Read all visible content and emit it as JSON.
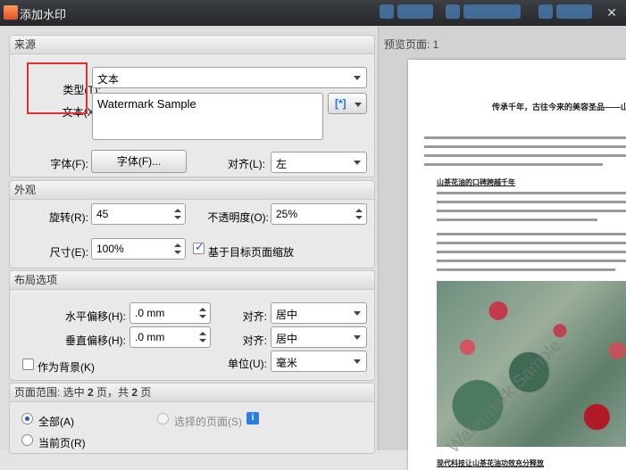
{
  "window": {
    "title": "添加水印"
  },
  "source": {
    "header": "来源",
    "type_label": "类型(T):",
    "type_value": "文本",
    "text_label": "文本(X):",
    "text_value": "Watermark Sample",
    "font_label": "字体(F):",
    "font_button": "字体(F)...",
    "align_label": "对齐(L):",
    "align_value": "左"
  },
  "appearance": {
    "header": "外观",
    "rotation_label": "旋转(R):",
    "rotation_value": "45",
    "opacity_label": "不透明度(O):",
    "opacity_value": "25%",
    "size_label": "尺寸(E):",
    "size_value": "100%",
    "scale_label": "基于目标页面缩放",
    "scale_checked": true
  },
  "layout": {
    "header": "布局选项",
    "hoffset_label": "水平偏移(H):",
    "hoffset_value": ".0 mm",
    "halign_label": "对齐:",
    "halign_value": "居中",
    "voffset_label": "垂直偏移(H):",
    "voffset_value": ".0 mm",
    "valign_label": "对齐:",
    "valign_value": "居中",
    "background_label": "作为背景(K)",
    "unit_label": "单位(U):",
    "unit_value": "毫米"
  },
  "page_range": {
    "header_prefix": "页面范围: 选中 ",
    "selected": "2",
    "header_mid": " 页，共 ",
    "total": "2",
    "header_suffix": " 页",
    "all_label": "全部(A)",
    "selected_label": "选择的页面(S)",
    "current_label": "当前页(R)"
  },
  "preview": {
    "label": "预览页面: 1",
    "doc_title": "传承千年，古往今来的美容圣品——山茶",
    "heading_1": "山茶花油的口碑跨越千年",
    "heading_2": "现代科技让山茶花油功效充分释放",
    "watermark": "Watermark Sample"
  },
  "colors": {
    "highlight": "#e03030",
    "accent": "#1a73e8"
  }
}
